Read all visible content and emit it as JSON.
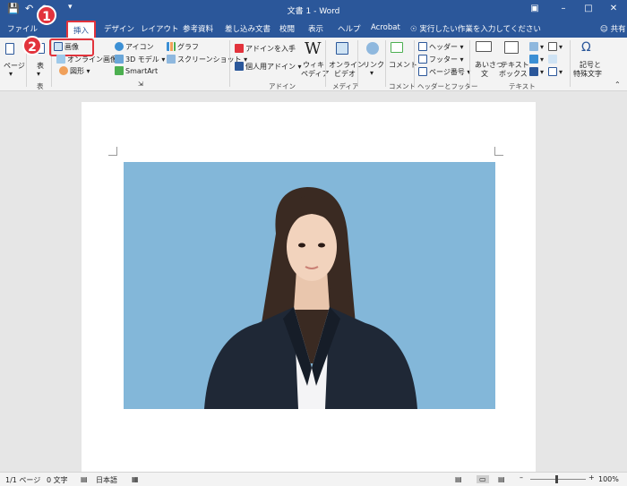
{
  "titlebar": {
    "title": "文書 1  -  Word",
    "quick_access": [
      "save",
      "undo",
      "redo",
      "customize"
    ]
  },
  "tabs": {
    "file": "ファイル",
    "home": "ホーム",
    "insert": "挿入",
    "design": "デザイン",
    "layout": "レイアウト",
    "references": "参考資料",
    "mailings": "差し込み文書",
    "review": "校閲",
    "view": "表示",
    "help": "ヘルプ",
    "acrobat": "Acrobat",
    "tell_me": "実行したい作業を入力してください",
    "share": "共有"
  },
  "ribbon": {
    "pages": "ページ",
    "table": "表",
    "table_group": "表",
    "pictures": "画像",
    "online_pictures": "オンライン画像",
    "shapes": "図形",
    "icons": "アイコン",
    "models_3d": "3D モデル",
    "smartart": "SmartArt",
    "chart": "グラフ",
    "screenshot": "スクリーンショット",
    "get_addins": "アドインを入手",
    "my_addins": "個人用アドイン",
    "wikipedia_1": "ウィキ",
    "wikipedia_2": "ペディア",
    "addins_group": "アドイン",
    "online_video_1": "オンライン",
    "online_video_2": "ビデオ",
    "media_group": "メディア",
    "link": "リンク",
    "comment": "コメント",
    "comment_group": "コメント",
    "header": "ヘッダー",
    "footer": "フッター",
    "page_number": "ページ番号",
    "header_footer_group": "ヘッダーとフッター",
    "greeting_1": "あいさつ",
    "greeting_2": "文",
    "textbox_1": "テキスト",
    "textbox_2": "ボックス",
    "text_group": "テキスト",
    "symbols_1": "記号と",
    "symbols_2": "特殊文字"
  },
  "annotations": {
    "step1": "1",
    "step2": "2"
  },
  "status": {
    "page": "1/1 ページ",
    "words": "0 文字",
    "language": "日本語",
    "zoom": "100%"
  },
  "colors": {
    "titlebar": "#2b579a",
    "highlight": "#e2333c",
    "photo_background": "#83b7d9"
  }
}
